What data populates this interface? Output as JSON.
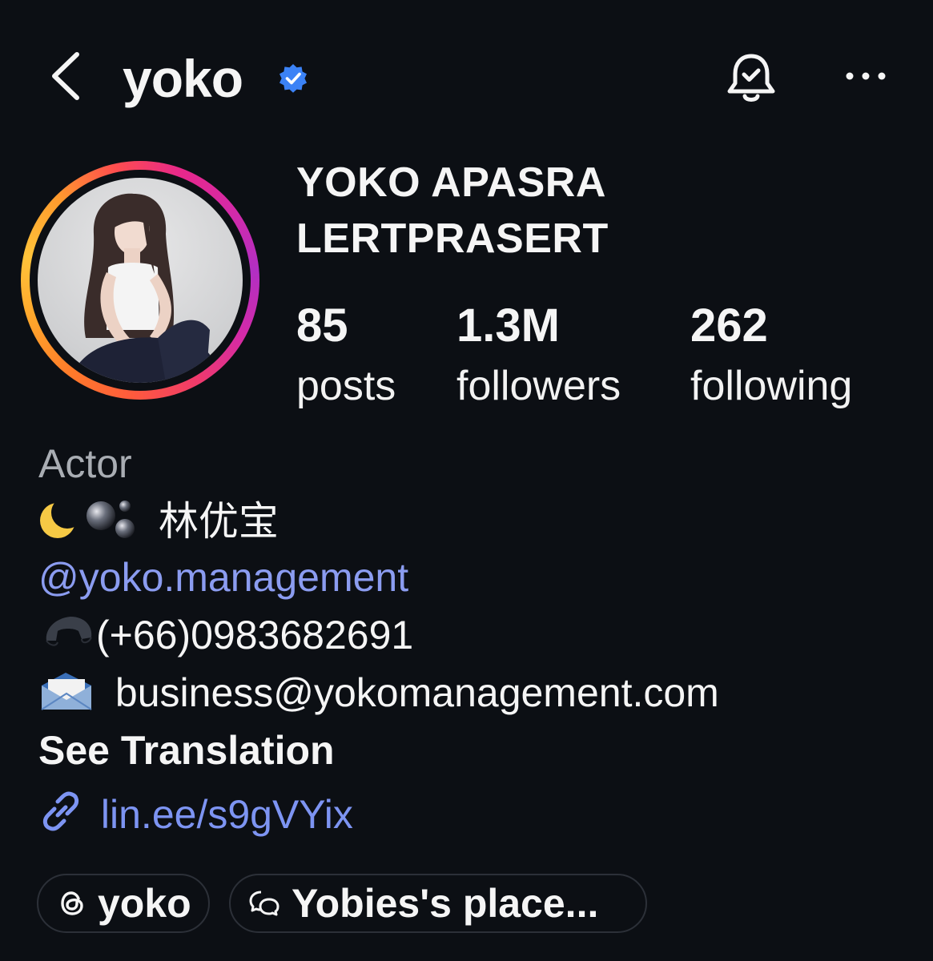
{
  "header": {
    "username": "yoko",
    "verified": true,
    "icons": [
      "chevron-left-icon",
      "verified-badge-icon",
      "bell-check-icon",
      "more-dots-icon"
    ]
  },
  "profile": {
    "full_name_line1": "YOKO APASRA",
    "full_name_line2": "LERTPRASERT",
    "stats": {
      "posts_count": "85",
      "posts_label": "posts",
      "followers_count": "1.3M",
      "followers_label": "followers",
      "following_count": "262",
      "following_label": "following"
    }
  },
  "bio": {
    "category": "Actor",
    "chinese_name": "林优宝",
    "mention": "@yoko.management",
    "phone": "(+66)0983682691",
    "email": "business@yokomanagement.com",
    "see_translation": "See Translation",
    "link": "lin.ee/s9gVYix"
  },
  "chips": {
    "threads_label": "yoko",
    "channel_label": "Yobies's place..."
  },
  "colors": {
    "background": "#0c0f14",
    "link_blue": "#8b9cf0",
    "verified_blue": "#3b82f6",
    "muted_text": "#a9adb3"
  }
}
